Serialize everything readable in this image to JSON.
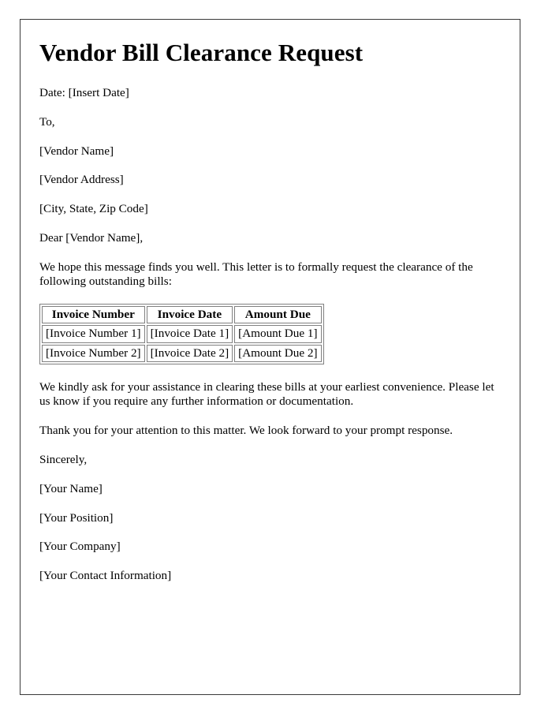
{
  "document": {
    "title": "Vendor Bill Clearance Request",
    "date_line": "Date: [Insert Date]",
    "salutation_to": "To,",
    "recipient": {
      "name": "[Vendor Name]",
      "address": "[Vendor Address]",
      "city_state_zip": "[City, State, Zip Code]"
    },
    "greeting": "Dear [Vendor Name],",
    "intro_paragraph": "We hope this message finds you well. This letter is to formally request the clearance of the following outstanding bills:",
    "table": {
      "headers": [
        "Invoice Number",
        "Invoice Date",
        "Amount Due"
      ],
      "rows": [
        [
          "[Invoice Number 1]",
          "[Invoice Date 1]",
          "[Amount Due 1]"
        ],
        [
          "[Invoice Number 2]",
          "[Invoice Date 2]",
          "[Amount Due 2]"
        ]
      ]
    },
    "request_paragraph": "We kindly ask for your assistance in clearing these bills at your earliest convenience. Please let us know if you require any further information or documentation.",
    "closing_paragraph": "Thank you for your attention to this matter. We look forward to your prompt response.",
    "sign_off": "Sincerely,",
    "signature": {
      "name": "[Your Name]",
      "position": "[Your Position]",
      "company": "[Your Company]",
      "contact": "[Your Contact Information]"
    }
  }
}
